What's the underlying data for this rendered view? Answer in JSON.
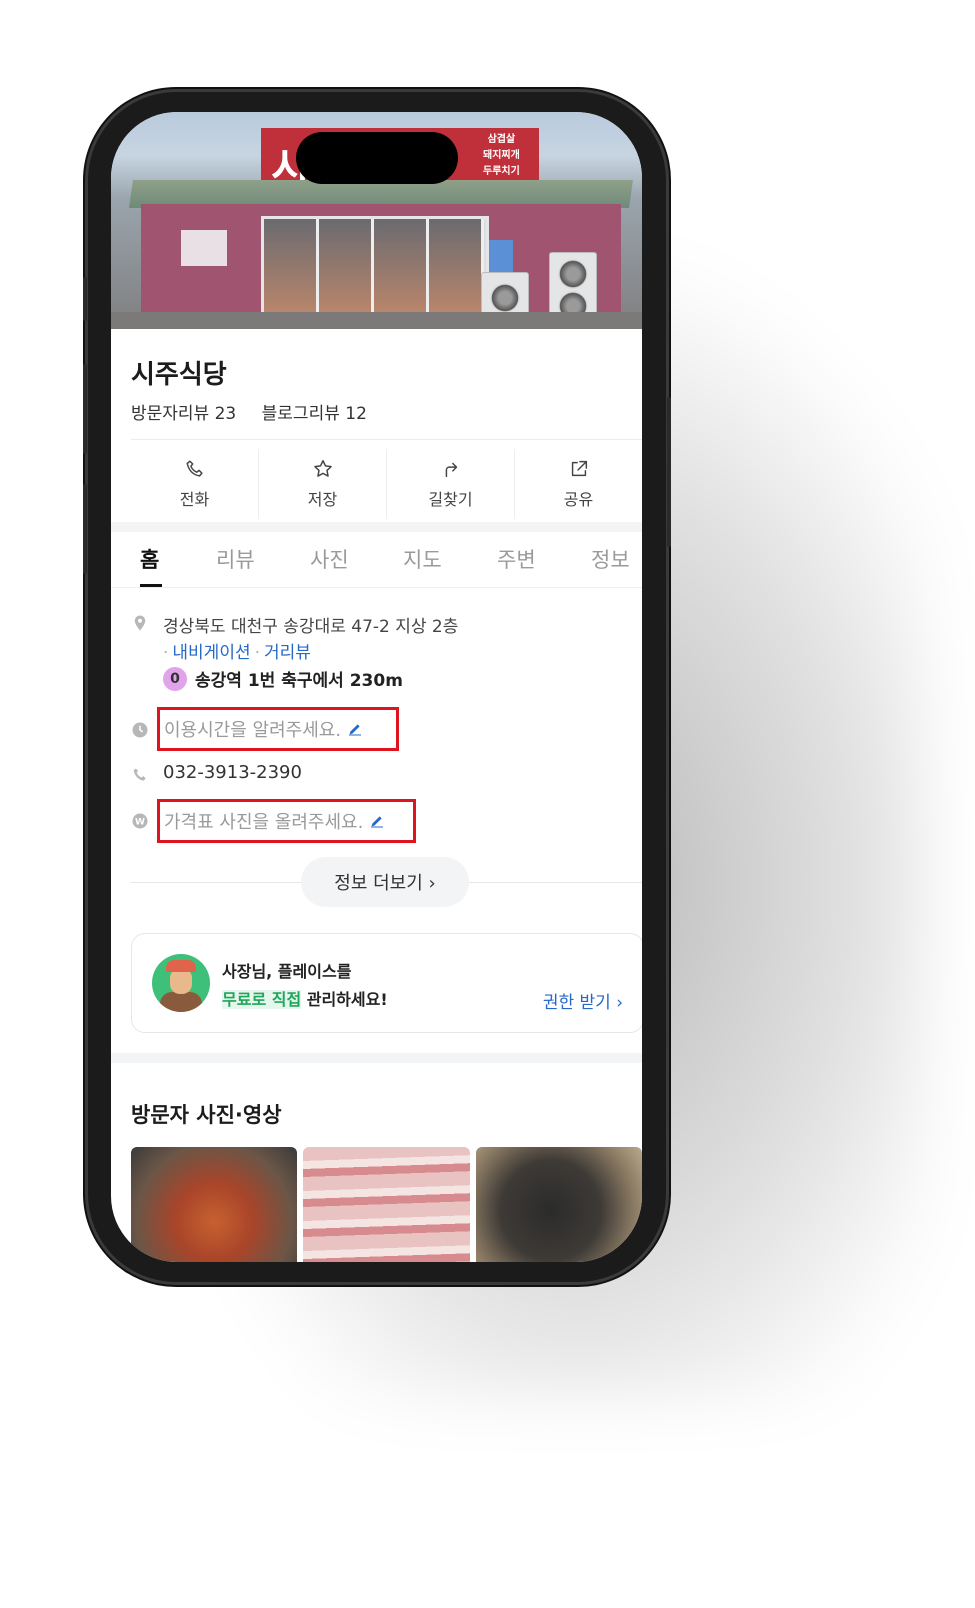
{
  "hero": {
    "sign_main": "시 당",
    "sign_sub": [
      "삼겹살",
      "돼지찌개",
      "두루치기"
    ]
  },
  "place": {
    "name": "시주식당",
    "visitor_reviews": "방문자리뷰 23",
    "blog_reviews": "블로그리뷰 12"
  },
  "actions": [
    {
      "label": "전화",
      "icon": "phone-icon"
    },
    {
      "label": "저장",
      "icon": "star-icon"
    },
    {
      "label": "길찾기",
      "icon": "directions-icon"
    },
    {
      "label": "공유",
      "icon": "share-icon"
    }
  ],
  "tabs": [
    "홈",
    "리뷰",
    "사진",
    "지도",
    "주변",
    "정보"
  ],
  "active_tab": "홈",
  "info": {
    "address": "경상북도 대천구 송강대로 47-2 지상 2층",
    "nav_link": "내비게이션",
    "street_view_link": "거리뷰",
    "subway_line": "0",
    "subway_text": "송강역 1번 축구에서 230m",
    "hours_hint": "이용시간을 알려주세요.",
    "phone": "032-3913-2390",
    "price_hint": "가격표 사진을 올려주세요.",
    "more_button": "정보 더보기 ›"
  },
  "owner_card": {
    "line1": "사장님, 플레이스를",
    "line2_highlight": "무료로 직접",
    "line2_rest": " 관리하세요!",
    "link": "권한 받기 ›"
  },
  "visitor_media": {
    "title": "방문자 사진·영상"
  },
  "colors": {
    "link": "#2668c8",
    "highlight_box": "#e0141e",
    "subway_badge": "#e1a3ea",
    "owner_highlight": "#1ea65a"
  }
}
